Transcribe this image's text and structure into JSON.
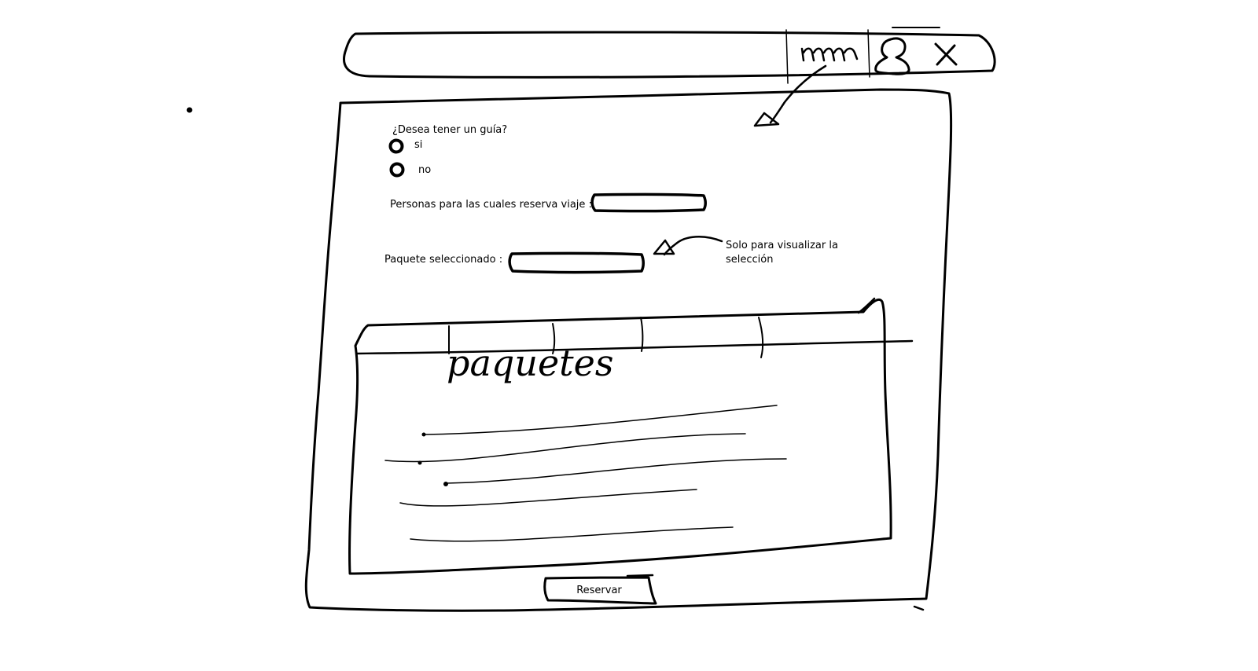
{
  "window": {
    "minimize_label": "nnn",
    "user_icon": "user-icon",
    "close_label": "X"
  },
  "form": {
    "guide_question": "¿Desea tener un guía?",
    "guide_options": [
      "si",
      "no"
    ],
    "persons_label": "Personas para las cuales reserva viaje :",
    "persons_value": "",
    "package_label": "Paquete seleccionado :",
    "package_value": ""
  },
  "annotation": {
    "text": "Solo para visualizar la selección"
  },
  "packages_panel": {
    "title": "paquetes"
  },
  "footer": {
    "reserve_label": "Reservar"
  }
}
